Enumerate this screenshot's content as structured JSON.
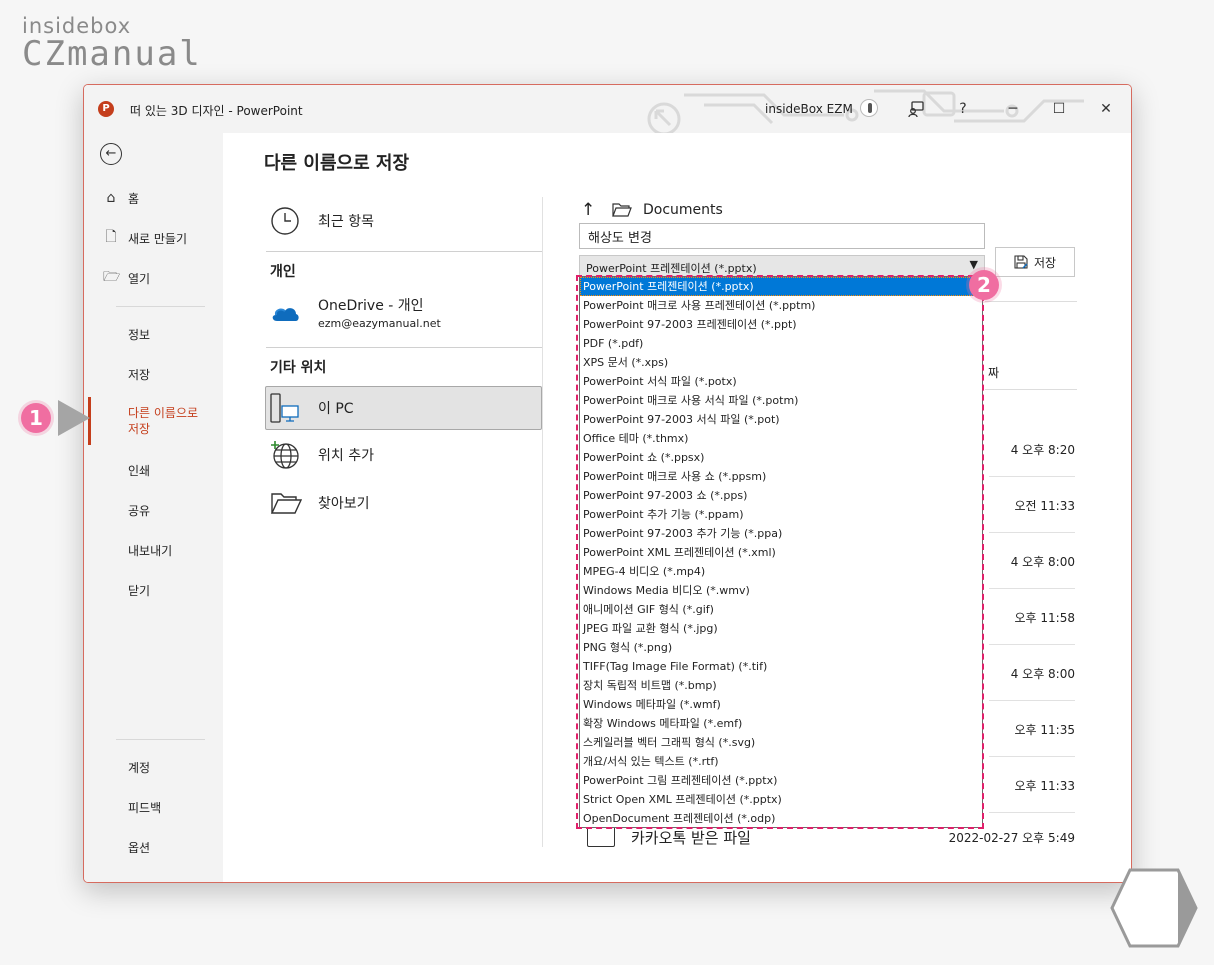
{
  "brand": {
    "line1": "insidebox",
    "line2": "CZmanual"
  },
  "window": {
    "app_icon": "powerpoint-icon",
    "title": "떠 있는 3D 디자인 - PowerPoint",
    "user_name": "insideBox EZM",
    "help_label": "?",
    "minimize_label": "─",
    "maximize_label": "☐",
    "close_label": "✕"
  },
  "sidebar": {
    "back_label": "←",
    "top_items": [
      {
        "icon": "home-icon",
        "glyph": "⌂",
        "label": "홈"
      },
      {
        "icon": "new-file-icon",
        "glyph": "🗋",
        "label": "새로 만들기"
      },
      {
        "icon": "open-folder-icon",
        "glyph": "🗁",
        "label": "열기"
      }
    ],
    "items": [
      "정보",
      "저장",
      "다른 이름으로 저장",
      "인쇄",
      "공유",
      "내보내기",
      "닫기"
    ],
    "active_label_1": "다른 이름으로",
    "active_label_2": "저장",
    "bottom_items": [
      "계정",
      "피드백",
      "옵션"
    ]
  },
  "main": {
    "title": "다른 이름으로 저장",
    "locations": {
      "recent": "최근 항목",
      "section_personal": "개인",
      "onedrive": "OneDrive - 개인",
      "onedrive_email": "ezm@eazymanual.net",
      "section_other": "기타 위치",
      "this_pc": "이 PC",
      "add_place": "위치 추가",
      "browse": "찾아보기"
    },
    "path": {
      "up_label": "↑",
      "folder": "Documents"
    },
    "filename_value": "해상도 변경",
    "file_type_selected": "PowerPoint 프레젠테이션 (*.pptx)",
    "save_button": "저장",
    "date_column_header": "짜",
    "file_dates": [
      "4 오후 8:20",
      "오전 11:33",
      "4 오후 8:00",
      "오후 11:58",
      "4 오후 8:00",
      "오후 11:35",
      "오후 11:33"
    ],
    "last_file": {
      "name": "카카오톡 받은 파일",
      "date": "2022-02-27 오후 5:49"
    }
  },
  "dropdown": {
    "selected_index": 0,
    "options": [
      "PowerPoint 프레젠테이션 (*.pptx)",
      "PowerPoint 매크로 사용 프레젠테이션 (*.pptm)",
      "PowerPoint 97-2003 프레젠테이션 (*.ppt)",
      "PDF (*.pdf)",
      "XPS 문서 (*.xps)",
      "PowerPoint 서식 파일 (*.potx)",
      "PowerPoint 매크로 사용 서식 파일 (*.potm)",
      "PowerPoint 97-2003 서식 파일 (*.pot)",
      "Office 테마 (*.thmx)",
      "PowerPoint 쇼 (*.ppsx)",
      "PowerPoint 매크로 사용 쇼 (*.ppsm)",
      "PowerPoint 97-2003 쇼 (*.pps)",
      "PowerPoint 추가 기능 (*.ppam)",
      "PowerPoint 97-2003 추가 기능 (*.ppa)",
      "PowerPoint XML 프레젠테이션 (*.xml)",
      "MPEG-4 비디오 (*.mp4)",
      "Windows Media 비디오 (*.wmv)",
      "애니메이션 GIF 형식 (*.gif)",
      "JPEG 파일 교환 형식 (*.jpg)",
      "PNG 형식 (*.png)",
      "TIFF(Tag Image File Format) (*.tif)",
      "장치 독립적 비트맵 (*.bmp)",
      "Windows 메타파일 (*.wmf)",
      "확장 Windows 메타파일 (*.emf)",
      "스케일러블 벡터 그래픽 형식 (*.svg)",
      "개요/서식 있는 텍스트 (*.rtf)",
      "PowerPoint 그림 프레젠테이션 (*.pptx)",
      "Strict Open XML 프레젠테이션 (*.pptx)",
      "OpenDocument 프레젠테이션 (*.odp)"
    ]
  },
  "annotations": {
    "badge1": "1",
    "badge2": "2",
    "accent": "#f06ea1"
  },
  "colors": {
    "ppt_accent": "#c43e1c",
    "selection": "#0078d7"
  }
}
